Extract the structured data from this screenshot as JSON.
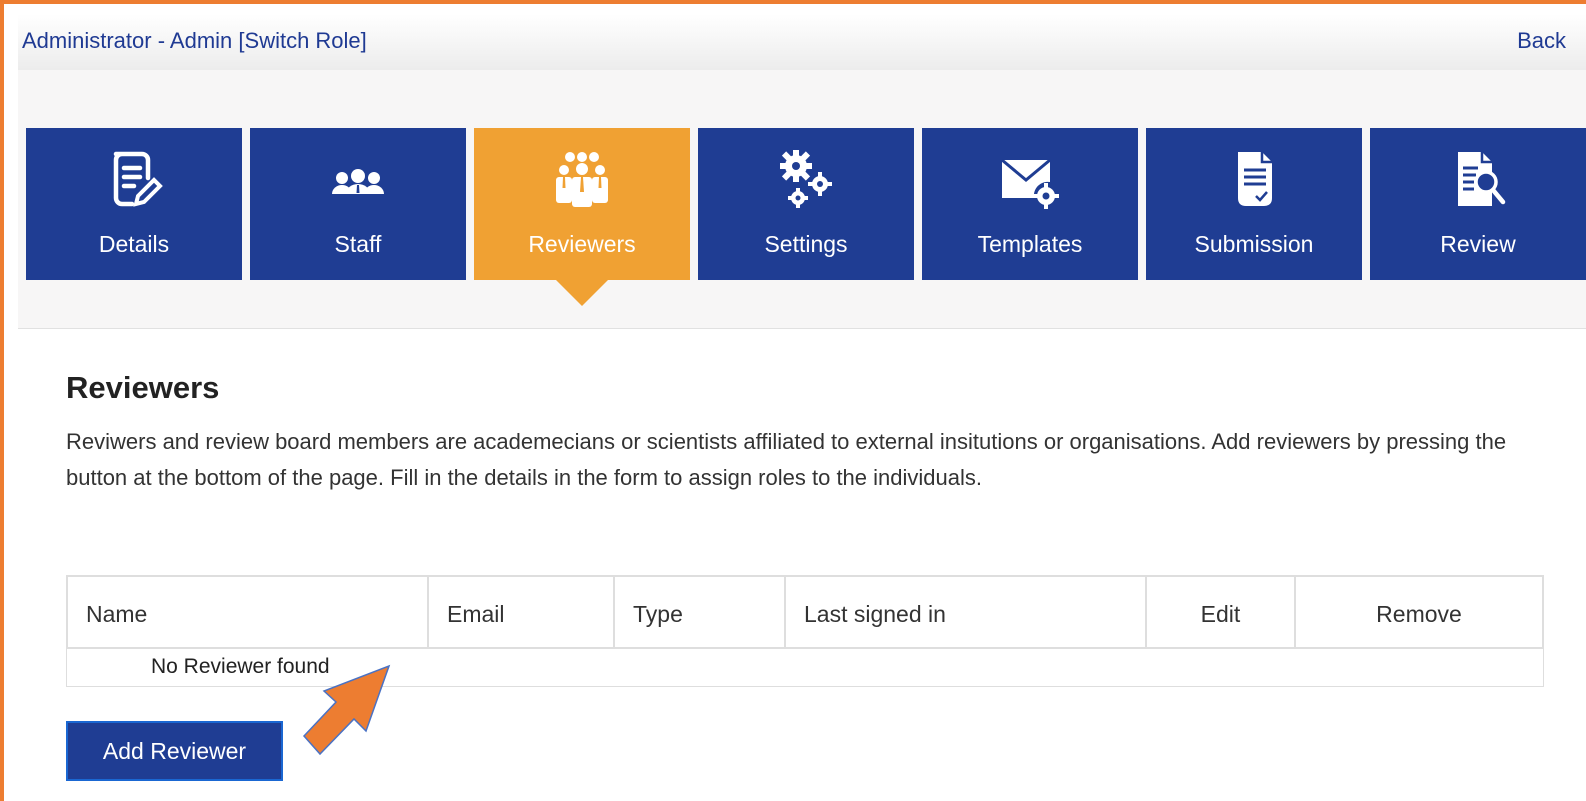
{
  "header": {
    "role_text": "Administrator - Admin [Switch Role]",
    "back_label": "Back"
  },
  "nav": {
    "active_tab": "Reviewers",
    "active_color": "#f0a133",
    "tab_color": "#1f3d93",
    "tabs": [
      {
        "label": "Details",
        "icon": "document-edit-icon"
      },
      {
        "label": "Staff",
        "icon": "staff-group-icon"
      },
      {
        "label": "Reviewers",
        "icon": "reviewers-group-icon"
      },
      {
        "label": "Settings",
        "icon": "gears-icon"
      },
      {
        "label": "Templates",
        "icon": "mail-gear-icon"
      },
      {
        "label": "Submission",
        "icon": "document-check-icon"
      },
      {
        "label": "Review",
        "icon": "document-search-icon"
      }
    ]
  },
  "main": {
    "title": "Reviewers",
    "description": "Reviwers and review board members are academecians or scientists affiliated to external insitutions or organisations. Add reviewers by pressing the button at the bottom of the page. Fill in the details in the form to assign roles to the individuals."
  },
  "table": {
    "columns": [
      "Name",
      "Email",
      "Type",
      "Last signed in",
      "Edit",
      "Remove"
    ],
    "empty_text": "No Reviewer found"
  },
  "actions": {
    "add_reviewer_label": "Add Reviewer"
  },
  "annotation": {
    "arrow_color": "#ed7d31"
  }
}
